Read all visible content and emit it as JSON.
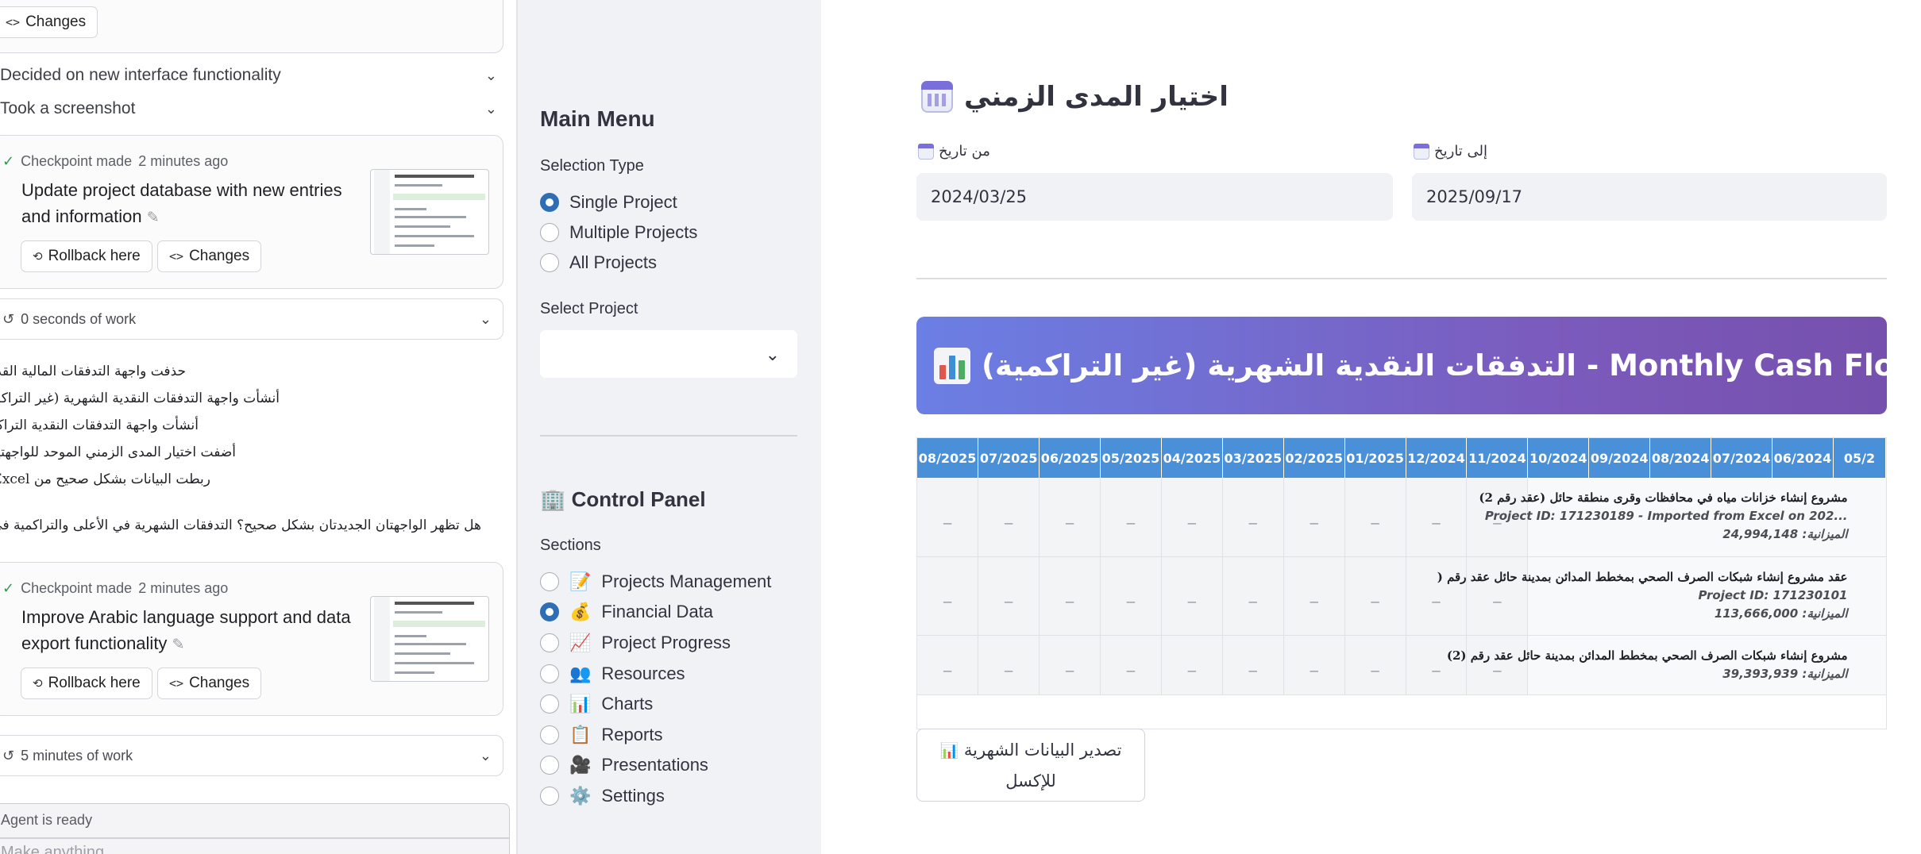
{
  "chat": {
    "changes_label": "Changes",
    "rollback_label": "Rollback here",
    "collapsed_1": "Decided on new interface functionality",
    "collapsed_2": "Took a screenshot",
    "checkpoint_1": {
      "status": "Checkpoint made",
      "time": "2 minutes ago",
      "title": "Update project database with new entries and information"
    },
    "work_1": "0 seconds of work",
    "summary_lines": [
      "حذفت واجهة التدفقات المالية القديمة",
      "أنشأت واجهة التدفقات النقدية الشهرية (غير التراكمية)",
      "أنشأت واجهة التدفقات النقدية التراكمية",
      "أضفت اختيار المدى الزمني الموحد للواجهتين",
      "ربطت البيانات بشكل صحيح من Excel"
    ],
    "question": "هل تظهر الواجهتان الجديدتان بشكل صحيح؟ التدفقات الشهرية في الأعلى والتراكمية في الأسفل",
    "checkpoint_2": {
      "status": "Checkpoint made",
      "time": "2 minutes ago",
      "title": "Improve Arabic language support and data export functionality"
    },
    "work_2": "5 minutes of work",
    "agent_status": "Agent is ready",
    "input_placeholder": "Make anything..."
  },
  "sidebar": {
    "main_menu": "Main Menu",
    "selection_type_label": "Selection Type",
    "selection_options": [
      "Single Project",
      "Multiple Projects",
      "All Projects"
    ],
    "selected_index": 0,
    "select_project_label": "Select Project",
    "select_project_value": "",
    "control_panel": "🏢 Control Panel",
    "sections_label": "Sections",
    "sections": [
      {
        "icon": "📝",
        "label": "Projects Management"
      },
      {
        "icon": "💰",
        "label": "Financial Data"
      },
      {
        "icon": "📈",
        "label": "Project Progress"
      },
      {
        "icon": "👥",
        "label": "Resources"
      },
      {
        "icon": "📊",
        "label": "Charts"
      },
      {
        "icon": "📋",
        "label": "Reports"
      },
      {
        "icon": "🎥",
        "label": "Presentations"
      },
      {
        "icon": "⚙️",
        "label": "Settings"
      }
    ],
    "selected_section": 1
  },
  "main": {
    "title": "اختيار المدى الزمني",
    "from_label": "من تاريخ",
    "from_value": "2024/03/25",
    "to_label": "إلى تاريخ",
    "to_value": "2025/09/17",
    "banner": "التدفقات النقدية الشهرية (غير التراكمية) - Monthly Cash Flows",
    "accent_gradient": [
      "#6b7fe4",
      "#7650ad"
    ],
    "table_header_color": "#4a90d9",
    "months": [
      "08/2025",
      "07/2025",
      "06/2025",
      "05/2025",
      "04/2025",
      "03/2025",
      "02/2025",
      "01/2025",
      "12/2024",
      "11/2024",
      "10/2024",
      "09/2024",
      "08/2024",
      "07/2024",
      "06/2024",
      "05/2"
    ],
    "projects": [
      {
        "name": "مشروع إنشاء خزانات مياه في محافظات وقرى منطقة حائل (عقد رقم 2)",
        "id": "Project ID: 171230189 - Imported from Excel on 202...",
        "budget": "الميزانية: 24,994,148"
      },
      {
        "name": "عقد مشروع إنشاء شبكات الصرف الصحي بمخطط المدائن بمدينة حائل عقد رقم (",
        "id": "Project ID: 171230101",
        "budget": "الميزانية: 113,666,000"
      },
      {
        "name": "مشروع إنشاء شبكات الصرف الصحي بمخطط المدائن بمدينة حائل عقد رقم (2)",
        "id": "",
        "budget": "الميزانية: 39,393,939"
      }
    ],
    "empty_cell": "_",
    "export_line1": "تصدير البيانات الشهرية",
    "export_line2": "للإكسل"
  }
}
